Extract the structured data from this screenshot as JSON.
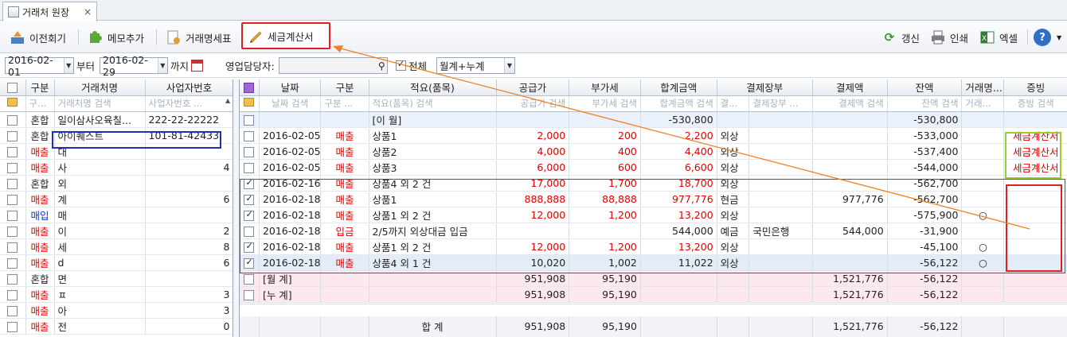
{
  "tab": {
    "title": "거래처 원장",
    "close": "×"
  },
  "toolbar": {
    "prev": "이전회기",
    "memo": "메모추가",
    "statement": "거래명세표",
    "tax_invoice": "세금계산서",
    "refresh": "갱신",
    "print": "인쇄",
    "excel": "엑셀",
    "help": "?"
  },
  "filter": {
    "date_from": "2016-02-01",
    "from_label": "부터",
    "date_to": "2016-02-29",
    "to_label": "까지",
    "sales_rep_label": "영업담당자:",
    "sales_rep_value": "",
    "all_label": "전체",
    "view_mode": "월계+누계"
  },
  "left_grid": {
    "headers": [
      "구분",
      "거래처명",
      "사업자번호"
    ],
    "search": [
      "구...",
      "거래처명 검색",
      "사업자번호 ..."
    ],
    "rows": [
      {
        "type": "혼합",
        "name": "일이삼사오육칠...",
        "biz": "222-22-22222"
      },
      {
        "type": "혼합",
        "name": "아이퀘스트",
        "biz": "101-81-42433"
      },
      {
        "type": "매출",
        "name": "대",
        "biz": ""
      },
      {
        "type": "매출",
        "name": "사",
        "biz": "4"
      },
      {
        "type": "혼합",
        "name": "외",
        "biz": ""
      },
      {
        "type": "매출",
        "name": "계",
        "biz": "6"
      },
      {
        "type": "매입",
        "name": "매",
        "biz": ""
      },
      {
        "type": "매출",
        "name": "이",
        "biz": "2"
      },
      {
        "type": "매출",
        "name": "세",
        "biz": "8"
      },
      {
        "type": "매출",
        "name": "d",
        "biz": "6"
      },
      {
        "type": "혼합",
        "name": "면",
        "biz": ""
      },
      {
        "type": "매출",
        "name": "ㅍ",
        "biz": "3"
      },
      {
        "type": "매출",
        "name": "아",
        "biz": "3"
      },
      {
        "type": "매출",
        "name": "전",
        "biz": "0"
      }
    ]
  },
  "right_grid": {
    "headers": [
      "날짜",
      "구분",
      "적요(품목)",
      "공급가",
      "부가세",
      "합계금액",
      "결제장부",
      "",
      "결제액",
      "잔액",
      "거래명...",
      "증빙"
    ],
    "search": [
      "날짜 검색",
      "구분 ...",
      "적요(품목) 검색",
      "공급가 검색",
      "부가세 검색",
      "합계금액 검색",
      "결...",
      "결제장부 ...",
      "결제액 검색",
      "잔액 검색",
      "거래...",
      "증빙 검색"
    ],
    "rows": [
      {
        "style": "month",
        "checked": false,
        "date": "",
        "type": "",
        "desc": "[이    월]",
        "supply": "",
        "vat": "",
        "total": "-530,800",
        "pay": "",
        "book": "",
        "paid": "",
        "balance": "-530,800",
        "stmt": "",
        "proof": ""
      },
      {
        "style": "",
        "checked": false,
        "date": "2016-02-05",
        "type": "매출",
        "desc": "상품1",
        "supply": "2,000",
        "vat": "200",
        "total": "2,200",
        "pay": "외상",
        "book": "",
        "paid": "",
        "balance": "-533,000",
        "stmt": "",
        "proof": "세금계산서"
      },
      {
        "style": "",
        "checked": false,
        "date": "2016-02-05",
        "type": "매출",
        "desc": "상품2",
        "supply": "4,000",
        "vat": "400",
        "total": "4,400",
        "pay": "외상",
        "book": "",
        "paid": "",
        "balance": "-537,400",
        "stmt": "",
        "proof": "세금계산서"
      },
      {
        "style": "",
        "checked": false,
        "date": "2016-02-05",
        "type": "매출",
        "desc": "상품3",
        "supply": "6,000",
        "vat": "600",
        "total": "6,600",
        "pay": "외상",
        "book": "",
        "paid": "",
        "balance": "-544,000",
        "stmt": "",
        "proof": "세금계산서"
      },
      {
        "style": "",
        "checked": true,
        "date": "2016-02-16",
        "type": "매출",
        "desc": "상품4 외 2 건",
        "supply": "17,000",
        "vat": "1,700",
        "total": "18,700",
        "pay": "외상",
        "book": "",
        "paid": "",
        "balance": "-562,700",
        "stmt": "",
        "proof": ""
      },
      {
        "style": "",
        "checked": true,
        "date": "2016-02-18",
        "type": "매출",
        "desc": "상품1",
        "supply": "888,888",
        "vat": "88,888",
        "total": "977,776",
        "pay": "현금",
        "book": "",
        "paid": "977,776",
        "balance": "-562,700",
        "stmt": "",
        "proof": ""
      },
      {
        "style": "",
        "checked": true,
        "date": "2016-02-18",
        "type": "매출",
        "desc": "상품1 외 2 건",
        "supply": "12,000",
        "vat": "1,200",
        "total": "13,200",
        "pay": "외상",
        "book": "",
        "paid": "",
        "balance": "-575,900",
        "stmt": "○",
        "proof": ""
      },
      {
        "style": "",
        "checked": false,
        "date": "2016-02-18",
        "type": "입금",
        "desc": "2/5까지 외상대금 입금",
        "supply": "",
        "vat": "",
        "total": "544,000",
        "pay": "예금",
        "book": "국민은행",
        "paid": "544,000",
        "balance": "-31,900",
        "stmt": "",
        "proof": ""
      },
      {
        "style": "",
        "checked": true,
        "date": "2016-02-18",
        "type": "매출",
        "desc": "상품1 외 2 건",
        "supply": "12,000",
        "vat": "1,200",
        "total": "13,200",
        "pay": "외상",
        "book": "",
        "paid": "",
        "balance": "-45,100",
        "stmt": "○",
        "proof": ""
      },
      {
        "style": "sel",
        "checked": true,
        "date": "2016-02-18",
        "type": "매출",
        "desc": "상품4 외 1 건",
        "supply": "10,020",
        "vat": "1,002",
        "total": "11,022",
        "pay": "외상",
        "book": "",
        "paid": "",
        "balance": "-56,122",
        "stmt": "○",
        "proof": ""
      },
      {
        "style": "pink",
        "checked": false,
        "date": "[월    계]",
        "type": "",
        "desc": "",
        "supply": "951,908",
        "vat": "95,190",
        "total": "",
        "pay": "",
        "book": "",
        "paid": "1,521,776",
        "balance": "-56,122",
        "stmt": "",
        "proof": ""
      },
      {
        "style": "pink",
        "checked": false,
        "date": "[누    계]",
        "type": "",
        "desc": "",
        "supply": "951,908",
        "vat": "95,190",
        "total": "",
        "pay": "",
        "book": "",
        "paid": "1,521,776",
        "balance": "-56,122",
        "stmt": "",
        "proof": ""
      }
    ],
    "total": {
      "label": "합    계",
      "supply": "951,908",
      "vat": "95,190",
      "paid": "1,521,776",
      "balance": "-56,122"
    }
  },
  "colors": {
    "red": "#e00000",
    "highlight_red": "#e02020",
    "blue_box": "#2030b0",
    "green_box": "#9ccc30",
    "arrow": "#f08020"
  }
}
